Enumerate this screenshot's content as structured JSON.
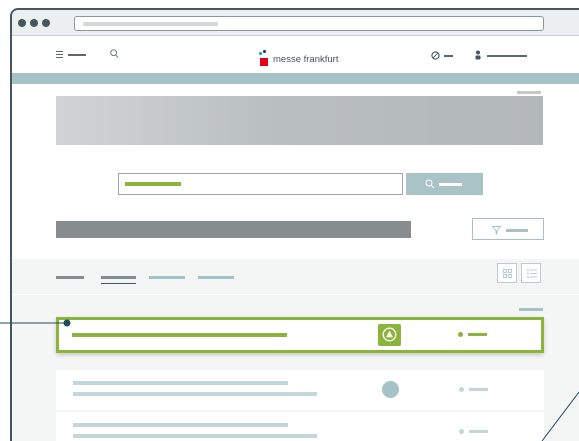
{
  "browser": {
    "url": ""
  },
  "header": {
    "logo_text": "messe frankfurt",
    "logo_colors": {
      "square": "#e2001a",
      "dot_light": "#009ee0",
      "dot_dark": "#1d2b65"
    },
    "icons": [
      "menu-icon",
      "search-icon",
      "globe-icon",
      "user-icon"
    ]
  },
  "colors": {
    "frame": "#46565f",
    "accent_green": "#8cb43c",
    "teal": "#a6c2c6",
    "teal_light": "#c3d6d9",
    "gray_bar": "#878c8f"
  },
  "search": {
    "input_value": "",
    "button_icon": "search-icon"
  },
  "filter": {
    "button_icon": "filter-icon"
  },
  "tabs": [
    {
      "state": "inactive"
    },
    {
      "state": "active"
    },
    {
      "state": "inactive"
    },
    {
      "state": "inactive"
    }
  ],
  "view_toggle": [
    "grid-view-icon",
    "list-view-icon"
  ],
  "list": {
    "rows": [
      {
        "state": "selected",
        "status_icon": "warning-triangle-icon"
      },
      {
        "state": "default",
        "status_icon": "circle-icon"
      },
      {
        "state": "default",
        "status_icon": "circle-icon"
      }
    ]
  }
}
